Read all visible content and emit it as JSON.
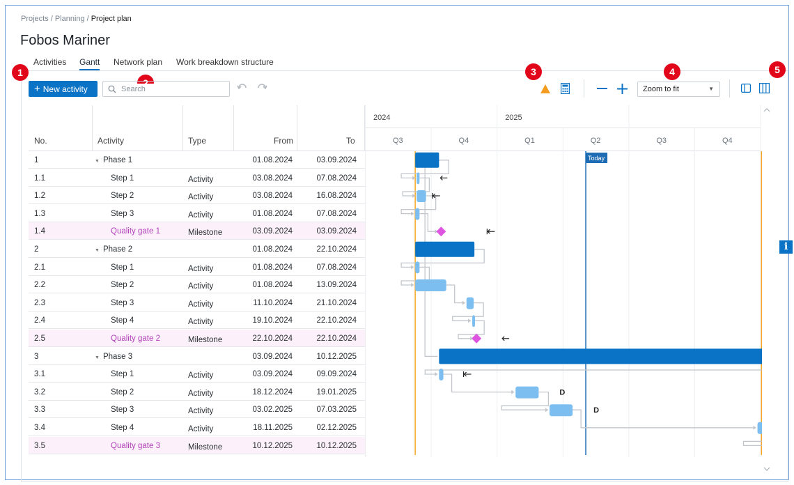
{
  "breadcrumb": [
    "Projects",
    "Planning",
    "Project plan"
  ],
  "page_title": "Fobos Mariner",
  "tabs": [
    {
      "label": "Activities",
      "active": false
    },
    {
      "label": "Gantt",
      "active": true
    },
    {
      "label": "Network plan",
      "active": false
    },
    {
      "label": "Work breakdown structure",
      "active": false
    }
  ],
  "badges": [
    "1",
    "2",
    "3",
    "4",
    "5"
  ],
  "toolbar": {
    "new_label": "New activity",
    "search_placeholder": "Search",
    "zoom_value": "Zoom to fit",
    "icons": [
      "plus-icon",
      "search-icon",
      "undo-icon",
      "redo-icon",
      "warning-icon",
      "calculator-icon",
      "zoom-out-icon",
      "zoom-in-icon",
      "chevron-down-icon",
      "panel-toggle-icon",
      "columns-icon"
    ]
  },
  "table": {
    "columns": [
      "No.",
      "Activity",
      "Type",
      "From",
      "To"
    ],
    "rows": [
      {
        "no": "1",
        "activity": "Phase 1",
        "type": "",
        "from": "01.08.2024",
        "to": "03.09.2024",
        "level": 0,
        "kind": "phase"
      },
      {
        "no": "1.1",
        "activity": "Step 1",
        "type": "Activity",
        "from": "03.08.2024",
        "to": "07.08.2024",
        "level": 1,
        "kind": "activity"
      },
      {
        "no": "1.2",
        "activity": "Step 2",
        "type": "Activity",
        "from": "03.08.2024",
        "to": "16.08.2024",
        "level": 1,
        "kind": "activity"
      },
      {
        "no": "1.3",
        "activity": "Step 3",
        "type": "Activity",
        "from": "01.08.2024",
        "to": "07.08.2024",
        "level": 1,
        "kind": "activity"
      },
      {
        "no": "1.4",
        "activity": "Quality gate 1",
        "type": "Milestone",
        "from": "03.09.2024",
        "to": "03.09.2024",
        "level": 1,
        "kind": "milestone"
      },
      {
        "no": "2",
        "activity": "Phase 2",
        "type": "",
        "from": "01.08.2024",
        "to": "22.10.2024",
        "level": 0,
        "kind": "phase"
      },
      {
        "no": "2.1",
        "activity": "Step 1",
        "type": "Activity",
        "from": "01.08.2024",
        "to": "07.08.2024",
        "level": 1,
        "kind": "activity"
      },
      {
        "no": "2.2",
        "activity": "Step 2",
        "type": "Activity",
        "from": "01.08.2024",
        "to": "13.09.2024",
        "level": 1,
        "kind": "activity"
      },
      {
        "no": "2.3",
        "activity": "Step 3",
        "type": "Activity",
        "from": "11.10.2024",
        "to": "21.10.2024",
        "level": 1,
        "kind": "activity"
      },
      {
        "no": "2.4",
        "activity": "Step 4",
        "type": "Activity",
        "from": "19.10.2024",
        "to": "22.10.2024",
        "level": 1,
        "kind": "activity"
      },
      {
        "no": "2.5",
        "activity": "Quality gate 2",
        "type": "Milestone",
        "from": "22.10.2024",
        "to": "22.10.2024",
        "level": 1,
        "kind": "milestone"
      },
      {
        "no": "3",
        "activity": "Phase 3",
        "type": "",
        "from": "03.09.2024",
        "to": "10.12.2025",
        "level": 0,
        "kind": "phase"
      },
      {
        "no": "3.1",
        "activity": "Step 1",
        "type": "Activity",
        "from": "03.09.2024",
        "to": "09.09.2024",
        "level": 1,
        "kind": "activity"
      },
      {
        "no": "3.2",
        "activity": "Step 2",
        "type": "Activity",
        "from": "18.12.2024",
        "to": "19.01.2025",
        "level": 1,
        "kind": "activity"
      },
      {
        "no": "3.3",
        "activity": "Step 3",
        "type": "Activity",
        "from": "03.02.2025",
        "to": "07.03.2025",
        "level": 1,
        "kind": "activity"
      },
      {
        "no": "3.4",
        "activity": "Step 4",
        "type": "Activity",
        "from": "18.11.2025",
        "to": "02.12.2025",
        "level": 1,
        "kind": "activity"
      },
      {
        "no": "3.5",
        "activity": "Quality gate 3",
        "type": "Milestone",
        "from": "10.12.2025",
        "to": "10.12.2025",
        "level": 1,
        "kind": "milestone"
      }
    ]
  },
  "gantt": {
    "years": [
      "2024",
      "2025"
    ],
    "quarters": [
      "Q3",
      "Q4",
      "Q1",
      "Q2",
      "Q3",
      "Q4"
    ],
    "today_label": "Today",
    "today_date": "2025-04-28",
    "markers": {
      "3.2": "D",
      "3.3": "D"
    },
    "colors": {
      "phase": "#0a73c5",
      "activity": "#7dbef0",
      "milestone": "#dd55e0",
      "link": "#c2c6cb",
      "today": "#1e6db4",
      "boundary": "#f5a623"
    }
  },
  "info_button": "i"
}
